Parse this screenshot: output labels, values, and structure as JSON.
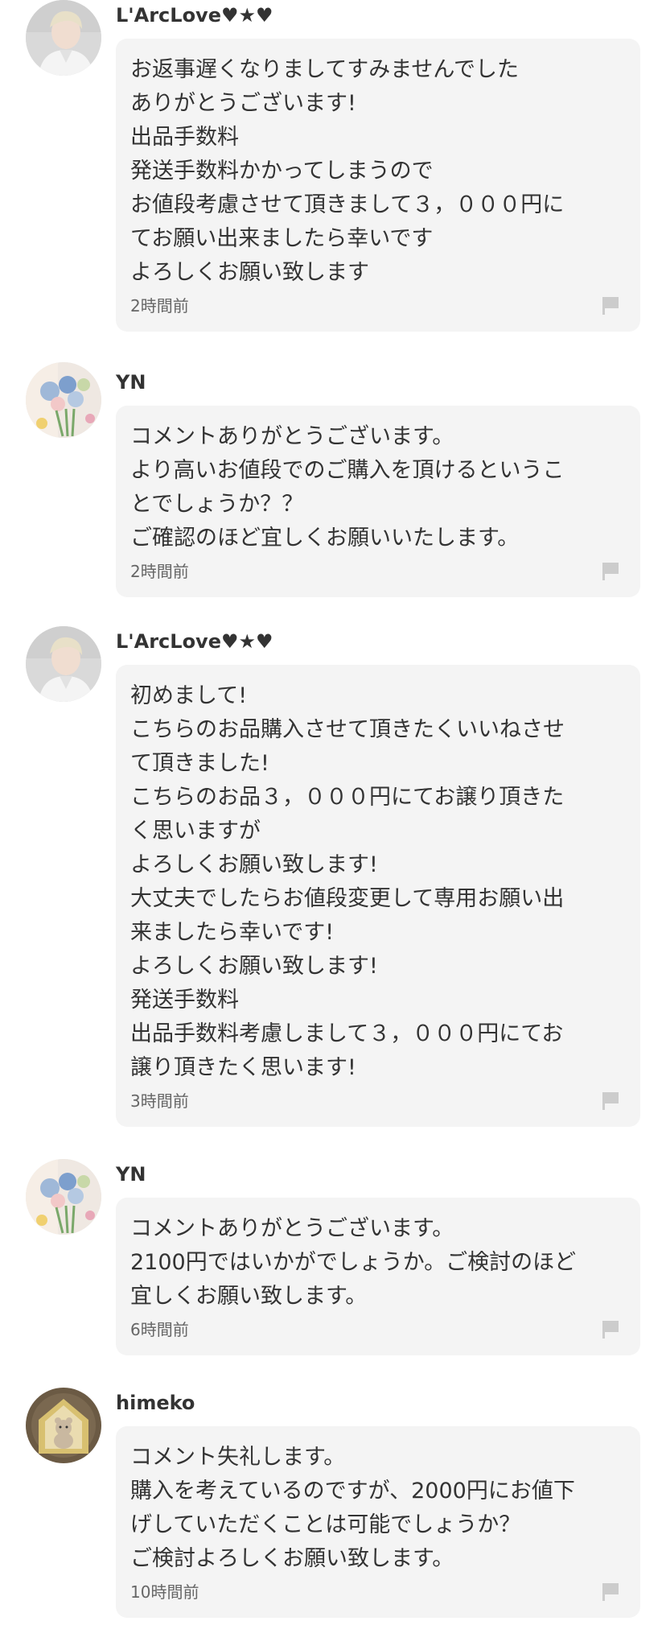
{
  "comments": [
    {
      "username": "L'ArcLove♥★♥",
      "avatar_icon": "person-photo-icon",
      "message": "お返事遅くなりましてすみませんでした\nありがとうございます!\n出品手数料\n発送手数料かかってしまうので\nお値段考慮させて頂きまして３，０００円に\nてお願い出来ましたら幸いです\nよろしくお願い致します",
      "time": "2時間前"
    },
    {
      "username": "YN",
      "avatar_icon": "flower-bouquet-icon",
      "message": "コメントありがとうございます。\nより高いお値段でのご購入を頂けるというこ\nとでしょうか？？\nご確認のほど宜しくお願いいたします。",
      "time": "2時間前"
    },
    {
      "username": "L'ArcLove♥★♥",
      "avatar_icon": "person-photo-icon",
      "message": "初めまして!\nこちらのお品購入させて頂きたくいいねさせ\nて頂きました!\nこちらのお品３，０００円にてお譲り頂きた\nく思いますが\nよろしくお願い致します!\n大丈夫でしたらお値段変更して専用お願い出\n来ましたら幸いです!\nよろしくお願い致します!\n発送手数料\n出品手数料考慮しまして３，０００円にてお\n譲り頂きたく思います!",
      "time": "3時間前"
    },
    {
      "username": "YN",
      "avatar_icon": "flower-bouquet-icon",
      "message": "コメントありがとうございます。\n2100円ではいかがでしょうか。ご検討のほど\n宜しくお願い致します。",
      "time": "6時間前"
    },
    {
      "username": "himeko",
      "avatar_icon": "bear-house-icon",
      "message": "コメント失礼します。\n購入を考えているのですが、2000円にお値下\nげしていただくことは可能でしょうか？\nご検討よろしくお願い致します。",
      "time": "10時間前"
    }
  ],
  "colors": {
    "bubble_bg": "#f4f4f4",
    "text": "#333333",
    "muted": "#666666",
    "flag": "#cccccc"
  }
}
